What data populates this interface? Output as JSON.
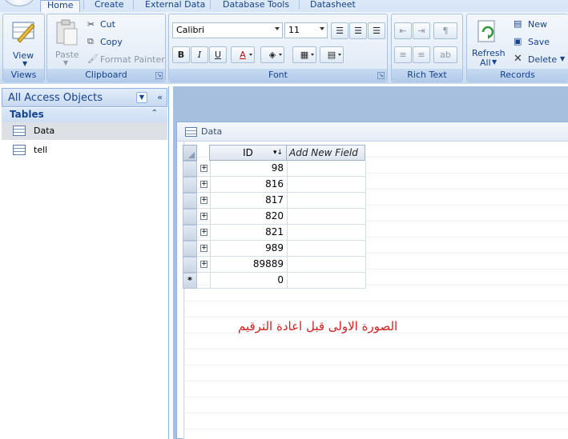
{
  "tabs": [
    "Home",
    "Create",
    "External Data",
    "Database Tools",
    "Datasheet"
  ],
  "groups": {
    "views": {
      "title": "Views",
      "view_label": "View"
    },
    "clipboard": {
      "title": "Clipboard",
      "paste_label": "Paste",
      "cut_label": "Cut",
      "copy_label": "Copy",
      "format_painter_label": "Format Painter"
    },
    "font": {
      "title": "Font",
      "font_name": "Calibri",
      "font_size": "11",
      "bold": "B",
      "italic": "I",
      "underline": "U",
      "font_color": "A"
    },
    "rich_text": {
      "title": "Rich Text"
    },
    "records": {
      "title": "Records",
      "refresh_label": "Refresh",
      "refresh_sub": "All",
      "new_label": "New",
      "save_label": "Save",
      "delete_label": "Delete"
    }
  },
  "nav": {
    "header": "All Access Objects",
    "group_label": "Tables",
    "items": [
      "Data",
      "tell"
    ]
  },
  "document": {
    "title": "Data",
    "columns": [
      "ID",
      "Add New Field"
    ],
    "rows": [
      "98",
      "816",
      "817",
      "820",
      "821",
      "989",
      "89889"
    ],
    "new_row_marker": "*",
    "new_row_value": "0"
  },
  "caption": "الصورة الاولى قبل اعادة الترقيم",
  "colors": {
    "accent": "#15428b",
    "caption": "#d21f1f",
    "workspace": "#a6bfdf"
  }
}
